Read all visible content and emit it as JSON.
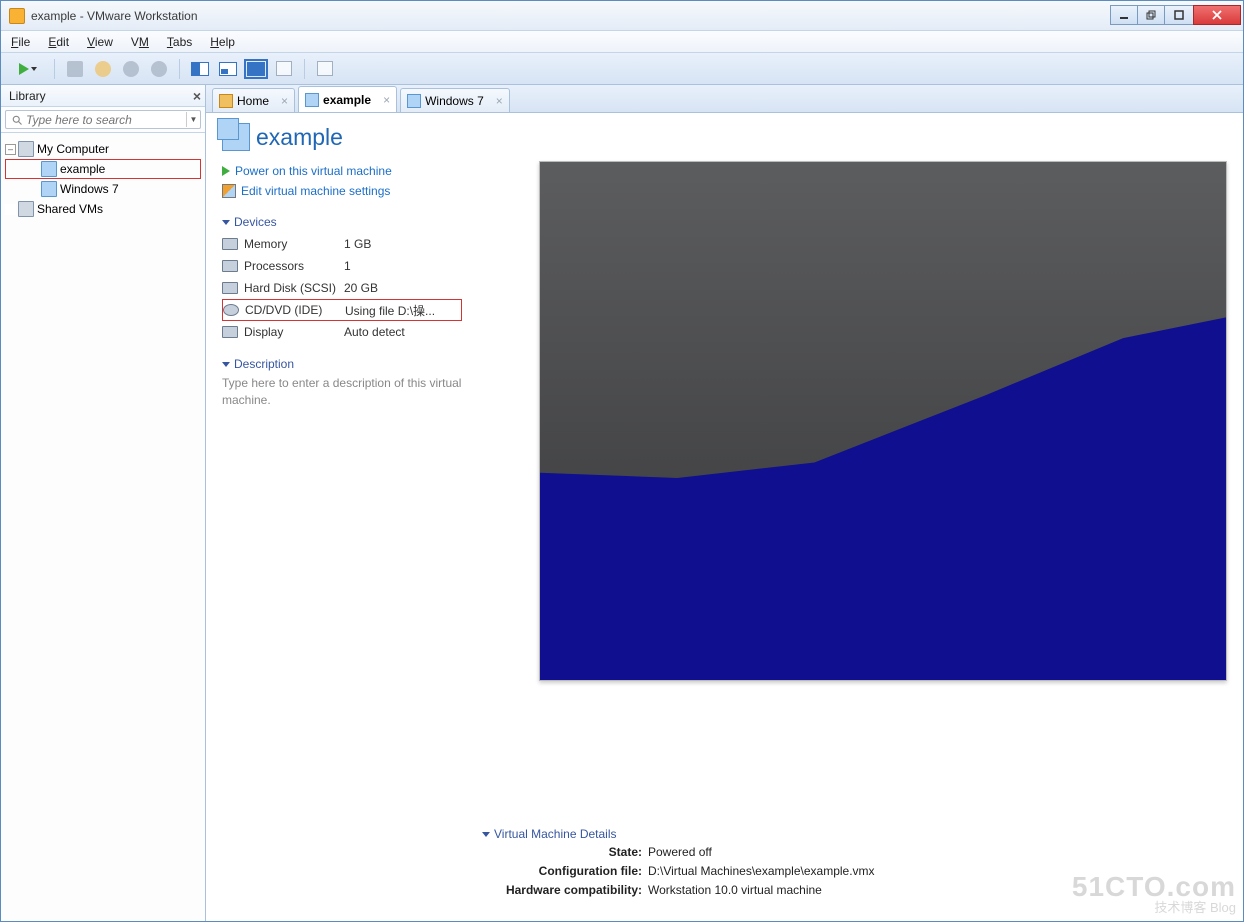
{
  "window": {
    "title": "example - VMware Workstation"
  },
  "menu": {
    "file": "File",
    "edit": "Edit",
    "view": "View",
    "vm": "VM",
    "tabs": "Tabs",
    "help": "Help"
  },
  "library": {
    "header": "Library",
    "search_placeholder": "Type here to search",
    "nodes": {
      "my_computer": "My Computer",
      "example": "example",
      "windows7": "Windows 7",
      "shared": "Shared VMs"
    }
  },
  "tabs": {
    "home": "Home",
    "example": "example",
    "windows7": "Windows 7"
  },
  "page": {
    "title": "example",
    "actions": {
      "power_on": "Power on this virtual machine",
      "edit": "Edit virtual machine settings"
    },
    "devices_head": "Devices",
    "devices": [
      {
        "name": "Memory",
        "value": "1 GB"
      },
      {
        "name": "Processors",
        "value": "1"
      },
      {
        "name": "Hard Disk (SCSI)",
        "value": "20 GB"
      },
      {
        "name": "CD/DVD (IDE)",
        "value": "Using file D:\\操..."
      },
      {
        "name": "Display",
        "value": "Auto detect"
      }
    ],
    "description_head": "Description",
    "description_placeholder": "Type here to enter a description of this virtual machine.",
    "details_head": "Virtual Machine Details",
    "details": {
      "state_k": "State:",
      "state_v": "Powered off",
      "config_k": "Configuration file:",
      "config_v": "D:\\Virtual Machines\\example\\example.vmx",
      "compat_k": "Hardware compatibility:",
      "compat_v": "Workstation 10.0 virtual machine"
    }
  },
  "watermark": {
    "l1": "51CTO.com",
    "l2": "技术博客 Blog"
  }
}
